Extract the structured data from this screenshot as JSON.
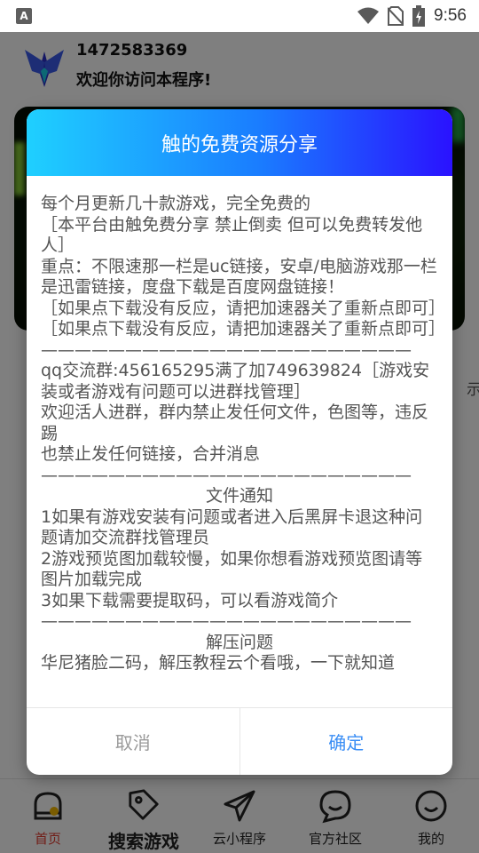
{
  "status_bar": {
    "left_icon": "A",
    "time": "9:56",
    "icons": [
      "wifi-icon",
      "no-sim-icon",
      "battery-charging-icon"
    ]
  },
  "header": {
    "user_id": "1472583369",
    "welcome": "欢迎你访问本程序!"
  },
  "side_text": "示",
  "dialog": {
    "title": "触的免费资源分享",
    "lines": [
      "每个月更新几十款游戏，完全免费的",
      "［本平台由触免费分享 禁止倒卖 但可以免费转发他人］",
      "重点：不限速那一栏是uc链接，安卓/电脑游戏那一栏是迅雷链接，度盘下载是百度网盘链接！",
      "［如果点下载没有反应，请把加速器关了重新点即可］",
      "［如果点下载没有反应，请把加速器关了重新点即可］",
      "——————————————————————",
      "qq交流群:456165295满了加749639824［游戏安装或者游戏有问题可以进群找管理］",
      "欢迎活人进群，群内禁止发任何文件，色图等，违反踢",
      "也禁止发任何链接，合并消息",
      "——————————————————————",
      "文件通知",
      "1如果有游戏安装有问题或者进入后黑屏卡退这种问题请加交流群找管理员",
      "2游戏预览图加载较慢，如果你想看游戏预览图请等图片加载完成",
      "3如果下载需要提取码，可以看游戏简介",
      "——————————————————————",
      "解压问题",
      "华尼猪脸二码，解压教程云个看哦，一下就知道"
    ],
    "cancel_label": "取消",
    "ok_label": "确定"
  },
  "bottom_nav": [
    {
      "label": "首页",
      "icon": "home-icon",
      "active": true
    },
    {
      "label": "搜索游戏",
      "icon": "tag-icon",
      "active": false
    },
    {
      "label": "云小程序",
      "icon": "send-icon",
      "active": false
    },
    {
      "label": "官方社区",
      "icon": "chat-icon",
      "active": false
    },
    {
      "label": "我的",
      "icon": "smile-icon",
      "active": false
    }
  ],
  "colors": {
    "accent": "#3a8ef5",
    "active_nav": "#e23b2e",
    "dialog_gradient": [
      "#1fd0ff",
      "#1a7cff",
      "#2a12ff"
    ]
  }
}
